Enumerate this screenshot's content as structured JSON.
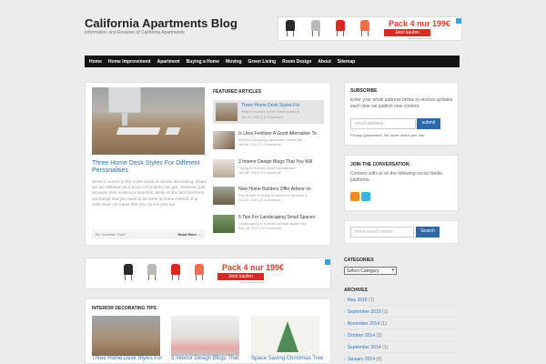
{
  "site": {
    "title": "California Apartments Blog",
    "description": "Information and Reviews of California Apartments"
  },
  "ad": {
    "headline": "Pack 4 nur 199€",
    "cta": "Jetzt kaufen",
    "domain": "www.moderium.com",
    "chair_colors": [
      "#2a2a2a",
      "#b9b9b9",
      "#d62a20",
      "#f26e50"
    ]
  },
  "nav": {
    "items": [
      "Home",
      "Home Improvement",
      "Apartment",
      "Buying a Home",
      "Moving",
      "Green Living",
      "Room Design",
      "About",
      "Sitemap"
    ]
  },
  "featured": {
    "main_title": "Three Home Desk Styles For Different Personalities",
    "main_excerpt": "When it comes to the entire world of interior decorating, desks are as utilitarian as a piece of furniture can get. However, just because their existence depends solely on the fact that there are things that you need to be done at home instead of at work does not mean that you cannot pick out",
    "author": "By Jonathan Clark",
    "read_more": "Read More →",
    "heading": "FEATURED ARTICLES",
    "articles": [
      {
        "title": "Three Home Desk Styles For",
        "excerpt": "When it comes to the entire world of",
        "meta": "Jan 14, 2014 | 0 Comments"
      },
      {
        "title": "Is Urea Fertilizer A Good Alternative To",
        "excerpt": "With the dropping barometer comes the",
        "meta": "Jan 08, 2014 | 0 Comments"
      },
      {
        "title": "3 Interior Design Blogs That You Will",
        "excerpt": "Trying to find the most inspirational",
        "meta": "Jan 06, 2014 | 0 Comments"
      },
      {
        "title": "New Home Builders Offer Advice on",
        "excerpt": "The dream of many renters is to become a",
        "meta": "Oct 20, 2013 | 0 Comments"
      },
      {
        "title": "5 Tips For Landscaping Small Spaces:",
        "excerpt": "Landscaping in a small outdoor space can",
        "meta": "Sep 28, 2013 | 0 Comments"
      }
    ]
  },
  "interior": {
    "heading": "INTERIOR DECORATING TIPS",
    "titles": [
      "Three Home Desk Styles For",
      "3 Interior Design Blogs That",
      "Space Saving Christmas Tree"
    ]
  },
  "sidebar": {
    "subscribe_heading": "SUBSCRIBE",
    "subscribe_text": "Enter your email address below to receive updates each time we publish new content.",
    "email_placeholder": "email address",
    "submit_label": "submit",
    "privacy": "Privacy guaranteed. We never share your info.",
    "join_heading": "JOIN THE CONVERSATION:",
    "join_text": "Connect with us on the following social media platforms.",
    "search_placeholder": "enter search terms",
    "search_label": "Search",
    "categories_heading": "CATEGORIES",
    "category_selected": "Select Category",
    "archives_heading": "ARCHIVES",
    "archives": [
      {
        "month": "May 2016",
        "count": "(1)"
      },
      {
        "month": "September 2015",
        "count": "(1)"
      },
      {
        "month": "November 2014",
        "count": "(1)"
      },
      {
        "month": "October 2014",
        "count": "(2)"
      },
      {
        "month": "September 2014",
        "count": "(1)"
      },
      {
        "month": "January 2014",
        "count": "(6)"
      }
    ]
  },
  "colors": {
    "accent": "#2f72b5",
    "nav_bg": "#141414",
    "button": "#2f67a4"
  }
}
